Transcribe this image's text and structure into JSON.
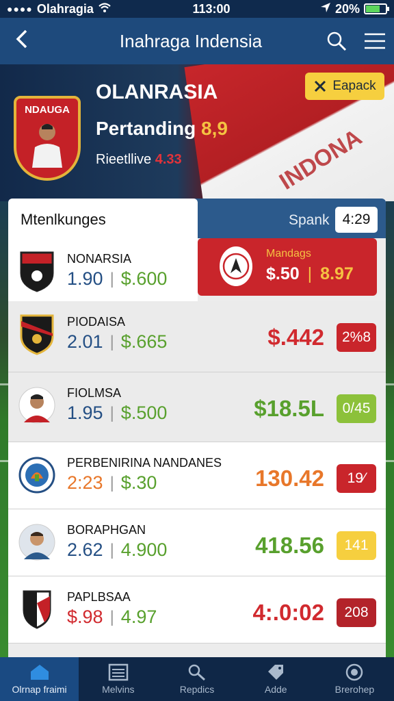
{
  "status_bar": {
    "carrier": "Olahragia",
    "time": "113:00",
    "battery": "20%",
    "battery_level": 0.7
  },
  "header": {
    "title": "Inahraga Indensia",
    "back_icon": "chevron-left-icon",
    "search_icon": "search-icon",
    "menu_icon": "hamburger-menu-icon"
  },
  "hero": {
    "crest_label": "NDAUGA",
    "brand": "OLANRASIA",
    "subtitle": "Pertanding",
    "subtitle_value": "8,9",
    "live_label": "Rieetllive",
    "live_value": "4.33",
    "flag_text": "INDONA",
    "action_label": "Eapack"
  },
  "panel": {
    "title": "Mtenlkunges",
    "spank_label": "Spank",
    "spank_value": "4:29",
    "featured": {
      "name": "Mandags",
      "value_a": "$.50",
      "value_b": "8.97"
    },
    "rows": [
      {
        "name": "NONARSIA",
        "odd1": "1.90",
        "odd2": "$.600",
        "big": "",
        "chip": ""
      },
      {
        "name": "PIODAISA",
        "odd1": "2.01",
        "odd2": "$.665",
        "big": "$.442",
        "chip": "2%8"
      },
      {
        "name": "FIOLMSA",
        "odd1": "1.95",
        "odd2": "$.500",
        "big": "$18.5L",
        "chip": "0/45"
      },
      {
        "name": "PERBENIRINA NANDANES",
        "odd1": "2:23",
        "odd2": "$.30",
        "big": "130.42",
        "chip": "19⁄"
      },
      {
        "name": "BORAPHGAN",
        "odd1": "2.62",
        "odd2": "4.900",
        "big": "418.56",
        "chip": "141"
      },
      {
        "name": "PAPLBSAA",
        "odd1": "$.98",
        "odd2": "4.97",
        "big": "4:.0:02",
        "chip": "208"
      }
    ]
  },
  "bottom_nav": {
    "items": [
      {
        "label": "Olrnap fraimi",
        "icon": "home-icon"
      },
      {
        "label": "Melvins",
        "icon": "list-icon"
      },
      {
        "label": "Repdics",
        "icon": "search-icon"
      },
      {
        "label": "Adde",
        "icon": "tag-icon"
      },
      {
        "label": "Brerohep",
        "icon": "ball-icon"
      }
    ]
  },
  "colors": {
    "header": "#1e4a7c",
    "accent_red": "#c9252b",
    "accent_yellow": "#f6cf3f",
    "green": "#58a02d"
  }
}
